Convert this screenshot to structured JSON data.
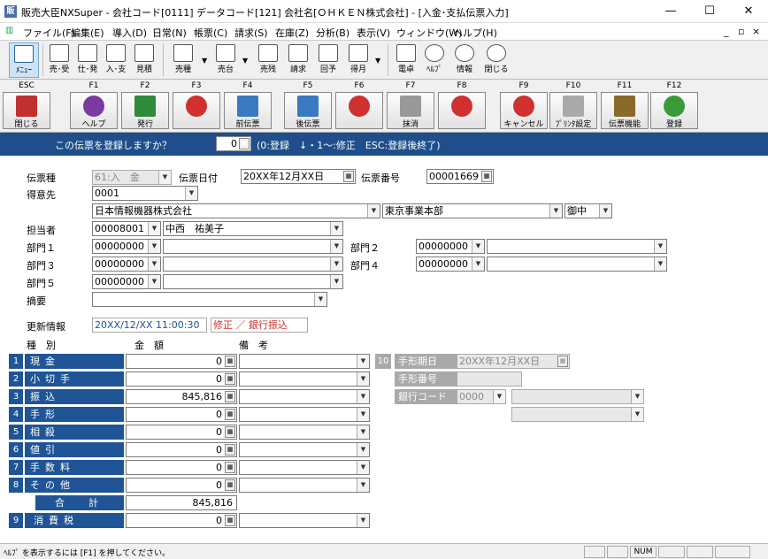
{
  "window": {
    "title": "販売大臣NXSuper - 会社コード[0111] データコード[121] 会社名[ＯＨＫＥＮ株式会社] - [入金･支払伝票入力]",
    "app_icon": "販",
    "minimize": "—",
    "maximize": "☐",
    "close": "✕"
  },
  "menu": [
    "ファイル(F)",
    "編集(E)",
    "導入(D)",
    "日常(N)",
    "帳票(C)",
    "請求(S)",
    "在庫(Z)",
    "分析(B)",
    "表示(V)",
    "ウィンドウ(W)",
    "ヘルプ(H)"
  ],
  "mdi_controls": [
    "_",
    "▫",
    "×"
  ],
  "toolbar": [
    {
      "name": "menu",
      "label": "ﾒﾆｭｰ"
    },
    {
      "name": "uriage-ukeire",
      "label": "売･受"
    },
    {
      "name": "shiire-hachu",
      "label": "仕･発"
    },
    {
      "name": "nyuukin-shiharai",
      "label": "入･支"
    },
    {
      "name": "mitsumori",
      "label": "見積"
    },
    {
      "name": "baidaka",
      "label": "売種"
    },
    {
      "name": "uriage-daichou",
      "label": "売台"
    },
    {
      "name": "urizan",
      "label": "売残"
    },
    {
      "name": "seikyuu",
      "label": "請求"
    },
    {
      "name": "kaiyo",
      "label": "回予"
    },
    {
      "name": "tokugetsu",
      "label": "得月"
    },
    {
      "name": "dentaku",
      "label": "電卓"
    },
    {
      "name": "help",
      "label": "ﾍﾙﾌﾟ"
    },
    {
      "name": "info",
      "label": "情報"
    },
    {
      "name": "close",
      "label": "閉じる"
    }
  ],
  "fkeys": [
    {
      "key": "ESC",
      "label": "閉じる",
      "color": "#c03030"
    },
    {
      "key": "F1",
      "label": "ヘルプ",
      "color": "#7a3aa0"
    },
    {
      "key": "F2",
      "label": "発行",
      "color": "#2f8a3a"
    },
    {
      "key": "F3",
      "label": "",
      "color": "#d03030"
    },
    {
      "key": "F4",
      "label": "前伝票",
      "color": "#3a7ac0"
    },
    {
      "key": "F5",
      "label": "後伝票",
      "color": "#3a7ac0"
    },
    {
      "key": "F6",
      "label": "",
      "color": "#d03030"
    },
    {
      "key": "F7",
      "label": "抹消",
      "color": "#888888"
    },
    {
      "key": "F8",
      "label": "",
      "color": "#d03030"
    },
    {
      "key": "F9",
      "label": "キャンセル",
      "color": "#d03030"
    },
    {
      "key": "F10",
      "label": "ﾌﾟﾘﾝﾀ設定",
      "color": "#888888"
    },
    {
      "key": "F11",
      "label": "伝票機能",
      "color": "#8a6a2a"
    },
    {
      "key": "F12",
      "label": "登録",
      "color": "#3a9a3a"
    }
  ],
  "prompt": {
    "question": "この伝票を登録しますか？",
    "value": "0",
    "hint": "(0:登録　↓・1～:修正　ESC:登録後終了)"
  },
  "header": {
    "denpyo_shu_label": "伝票種",
    "denpyo_shu_value": "61:入　金",
    "date_label": "伝票日付",
    "date_value": "20XX年12月XX日",
    "number_label": "伝票番号",
    "number_value": "00001669",
    "tokuisaki_label": "得意先",
    "tokuisaki_code": "0001",
    "tokuisaki_name": "日本情報機器株式会社",
    "tokuisaki_dept": "東京事業本部",
    "honorific": "御中",
    "tantou_label": "担当者",
    "tantou_code": "00008001",
    "tantou_name": "中西　祐美子",
    "bumon1_label": "部門１",
    "bumon1_code": "00000000",
    "bumon2_label": "部門２",
    "bumon2_code": "00000000",
    "bumon3_label": "部門３",
    "bumon3_code": "00000000",
    "bumon4_label": "部門４",
    "bumon4_code": "00000000",
    "bumon5_label": "部門５",
    "bumon5_code": "00000000",
    "tekiyou_label": "摘要",
    "tekiyou_value": "",
    "update_label": "更新情報",
    "update_value": "20XX/12/XX 11:00:30",
    "update_note": "修正 ／ 銀行振込"
  },
  "columns": {
    "kind": "種　別",
    "amount": "金　額",
    "remarks": "備　考"
  },
  "rows": [
    {
      "no": "1",
      "kind": "現金",
      "amount": "0",
      "remarks": ""
    },
    {
      "no": "2",
      "kind": "小切手",
      "amount": "0",
      "remarks": ""
    },
    {
      "no": "3",
      "kind": "振込",
      "amount": "845,816",
      "remarks": ""
    },
    {
      "no": "4",
      "kind": "手形",
      "amount": "0",
      "remarks": ""
    },
    {
      "no": "5",
      "kind": "相殺",
      "amount": "0",
      "remarks": ""
    },
    {
      "no": "6",
      "kind": "値引",
      "amount": "0",
      "remarks": ""
    },
    {
      "no": "7",
      "kind": "手数料",
      "amount": "0",
      "remarks": ""
    },
    {
      "no": "8",
      "kind": "その他",
      "amount": "0",
      "remarks": ""
    }
  ],
  "total": {
    "label": "合　計",
    "amount": "845,816"
  },
  "tax": {
    "no": "9",
    "kind": "消費税",
    "amount": "0"
  },
  "tegata": {
    "no": "10",
    "due_label": "手形期日",
    "due_value": "20XX年12月XX日",
    "number_label": "手形番号",
    "number_value": "",
    "bank_label": "銀行コード",
    "bank_code": "0000"
  },
  "status": {
    "text": "ﾍﾙﾌﾟ を表示するには [F1] を押してください。",
    "num": "NUM"
  }
}
